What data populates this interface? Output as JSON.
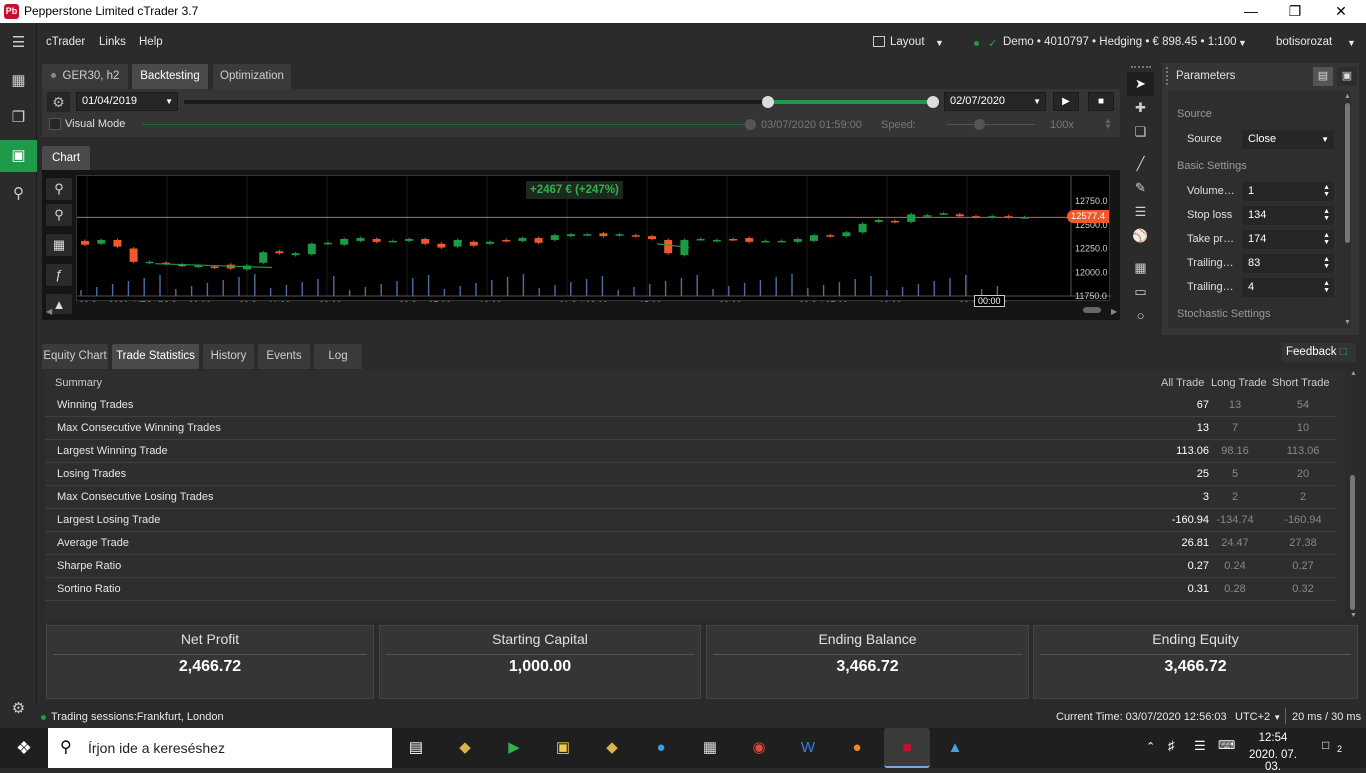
{
  "window": {
    "title": "Pepperstone Limited cTrader 3.7",
    "logo_text": "Pb"
  },
  "menu": {
    "items": [
      "cTrader",
      "Links",
      "Help"
    ],
    "layout_label": "Layout",
    "account": "Demo • 4010797 • Hedging • € 898.45 • 1:100",
    "user": "botisorozat"
  },
  "tabs": {
    "symbol_tab": "GER30, h2",
    "backtesting": "Backtesting",
    "optimization": "Optimization"
  },
  "backtest": {
    "start_date": "01/04/2019",
    "end_date": "02/07/2020",
    "visual_mode": "Visual Mode",
    "progress_time": "03/07/2020 01:59:00",
    "speed_label": "Speed:",
    "speed_value": "100x"
  },
  "chart_tab": "Chart",
  "chart": {
    "profit_badge": "+2467 € (+247%)",
    "current_price": "12577.4",
    "price_ticks": [
      "12750.0",
      "12500.0",
      "12250.0",
      "12000.0",
      "11750.0"
    ],
    "time_ticks": [
      "26 Jun 2020, UTC+2",
      "28 Jun 23:00",
      "29 Jun 11:00",
      "23:00",
      "30 Jun 07:00",
      "19:00",
      "01 Jul 03:00",
      "15:00",
      "23:00",
      "02 Jul 07:00",
      "19:00",
      "03 Jul 03:00"
    ],
    "cursor_time": "00:00",
    "colors": {
      "up": "#1d9a45",
      "down": "#f0592b",
      "price_line": "#f0592b"
    }
  },
  "chart_data": {
    "type": "candlestick",
    "symbol": "GER30, h2",
    "y_ticks": [
      11750,
      12000,
      12250,
      12500,
      12750
    ],
    "current_price": 12577.4,
    "candles": [
      {
        "o": 12330,
        "c": 12290
      },
      {
        "o": 12300,
        "c": 12340
      },
      {
        "o": 12340,
        "c": 12270
      },
      {
        "o": 12250,
        "c": 12110
      },
      {
        "o": 12100,
        "c": 12110
      },
      {
        "o": 12100,
        "c": 12090
      },
      {
        "o": 12080,
        "c": 12070
      },
      {
        "o": 12060,
        "c": 12070
      },
      {
        "o": 12060,
        "c": 12050
      },
      {
        "o": 12080,
        "c": 12040
      },
      {
        "o": 12030,
        "c": 12070
      },
      {
        "o": 12100,
        "c": 12210
      },
      {
        "o": 12220,
        "c": 12200
      },
      {
        "o": 12180,
        "c": 12200
      },
      {
        "o": 12190,
        "c": 12300
      },
      {
        "o": 12300,
        "c": 12310
      },
      {
        "o": 12290,
        "c": 12350
      },
      {
        "o": 12330,
        "c": 12360
      },
      {
        "o": 12350,
        "c": 12320
      },
      {
        "o": 12330,
        "c": 12330
      },
      {
        "o": 12330,
        "c": 12350
      },
      {
        "o": 12350,
        "c": 12300
      },
      {
        "o": 12300,
        "c": 12260
      },
      {
        "o": 12270,
        "c": 12340
      },
      {
        "o": 12320,
        "c": 12280
      },
      {
        "o": 12300,
        "c": 12320
      },
      {
        "o": 12340,
        "c": 12330
      },
      {
        "o": 12330,
        "c": 12360
      },
      {
        "o": 12360,
        "c": 12310
      },
      {
        "o": 12340,
        "c": 12390
      },
      {
        "o": 12380,
        "c": 12400
      },
      {
        "o": 12400,
        "c": 12400
      },
      {
        "o": 12410,
        "c": 12380
      },
      {
        "o": 12390,
        "c": 12400
      },
      {
        "o": 12390,
        "c": 12380
      },
      {
        "o": 12380,
        "c": 12350
      },
      {
        "o": 12340,
        "c": 12200
      },
      {
        "o": 12180,
        "c": 12340
      },
      {
        "o": 12350,
        "c": 12350
      },
      {
        "o": 12330,
        "c": 12340
      },
      {
        "o": 12350,
        "c": 12340
      },
      {
        "o": 12360,
        "c": 12320
      },
      {
        "o": 12330,
        "c": 12330
      },
      {
        "o": 12330,
        "c": 12330
      },
      {
        "o": 12320,
        "c": 12350
      },
      {
        "o": 12330,
        "c": 12390
      },
      {
        "o": 12390,
        "c": 12380
      },
      {
        "o": 12380,
        "c": 12420
      },
      {
        "o": 12420,
        "c": 12510
      },
      {
        "o": 12530,
        "c": 12550
      },
      {
        "o": 12540,
        "c": 12530
      },
      {
        "o": 12530,
        "c": 12610
      },
      {
        "o": 12600,
        "c": 12600
      },
      {
        "o": 12620,
        "c": 12620
      },
      {
        "o": 12610,
        "c": 12590
      },
      {
        "o": 12590,
        "c": 12580
      },
      {
        "o": 12580,
        "c": 12590
      },
      {
        "o": 12590,
        "c": 12580
      },
      {
        "o": 12580,
        "c": 12580
      }
    ]
  },
  "drawing_tools": [
    "cursor-icon",
    "crosshair-icon",
    "zoom-area-icon",
    "trendline-icon",
    "pencil-icon",
    "fibonacci-icon",
    "pitchfork-icon",
    "grid-icon",
    "rectangle-icon",
    "circle-icon"
  ],
  "parameters": {
    "title": "Parameters",
    "source_section": "Source",
    "source_label": "Source",
    "source_value": "Close",
    "basic_section": "Basic Settings",
    "rows": [
      {
        "label": "Volume…",
        "value": "1"
      },
      {
        "label": "Stop loss",
        "value": "134"
      },
      {
        "label": "Take pr…",
        "value": "174"
      },
      {
        "label": "Trailing…",
        "value": "83"
      },
      {
        "label": "Trailing…",
        "value": "4"
      }
    ],
    "stochastic_section": "Stochastic Settings"
  },
  "bottom_tabs": [
    "Equity Chart",
    "Trade Statistics",
    "History",
    "Events",
    "Log"
  ],
  "feedback": "Feedback",
  "stats": {
    "headers": {
      "summary": "Summary",
      "all": "All Trade",
      "long": "Long Trade",
      "short": "Short Trade"
    },
    "rows": [
      {
        "name": "Winning Trades",
        "all": "67",
        "long": "13",
        "short": "54"
      },
      {
        "name": "Max Consecutive Winning Trades",
        "all": "13",
        "long": "7",
        "short": "10"
      },
      {
        "name": "Largest Winning Trade",
        "all": "113.06",
        "long": "98.16",
        "short": "113.06"
      },
      {
        "name": "Losing Trades",
        "all": "25",
        "long": "5",
        "short": "20"
      },
      {
        "name": "Max Consecutive Losing Trades",
        "all": "3",
        "long": "2",
        "short": "2"
      },
      {
        "name": "Largest Losing Trade",
        "all": "-160.94",
        "long": "-134.74",
        "short": "-160.94"
      },
      {
        "name": "Average Trade",
        "all": "26.81",
        "long": "24.47",
        "short": "27.38"
      },
      {
        "name": "Sharpe Ratio",
        "all": "0.27",
        "long": "0.24",
        "short": "0.27"
      },
      {
        "name": "Sortino Ratio",
        "all": "0.31",
        "long": "0.28",
        "short": "0.32"
      }
    ]
  },
  "cards": [
    {
      "title": "Net Profit",
      "value": "2,466.72"
    },
    {
      "title": "Starting Capital",
      "value": "1,000.00"
    },
    {
      "title": "Ending Balance",
      "value": "3,466.72"
    },
    {
      "title": "Ending Equity",
      "value": "3,466.72"
    }
  ],
  "status": {
    "sessions": "Trading sessions:Frankfurt, London",
    "current_time": "Current Time: 03/07/2020 12:56:03",
    "timezone": "UTC+2",
    "latency": "20 ms / 30 ms"
  },
  "taskbar": {
    "search_placeholder": "Írjon ide a kereséshez",
    "time": "12:54",
    "date": "2020. 07. 03.",
    "notification_count": "2"
  }
}
